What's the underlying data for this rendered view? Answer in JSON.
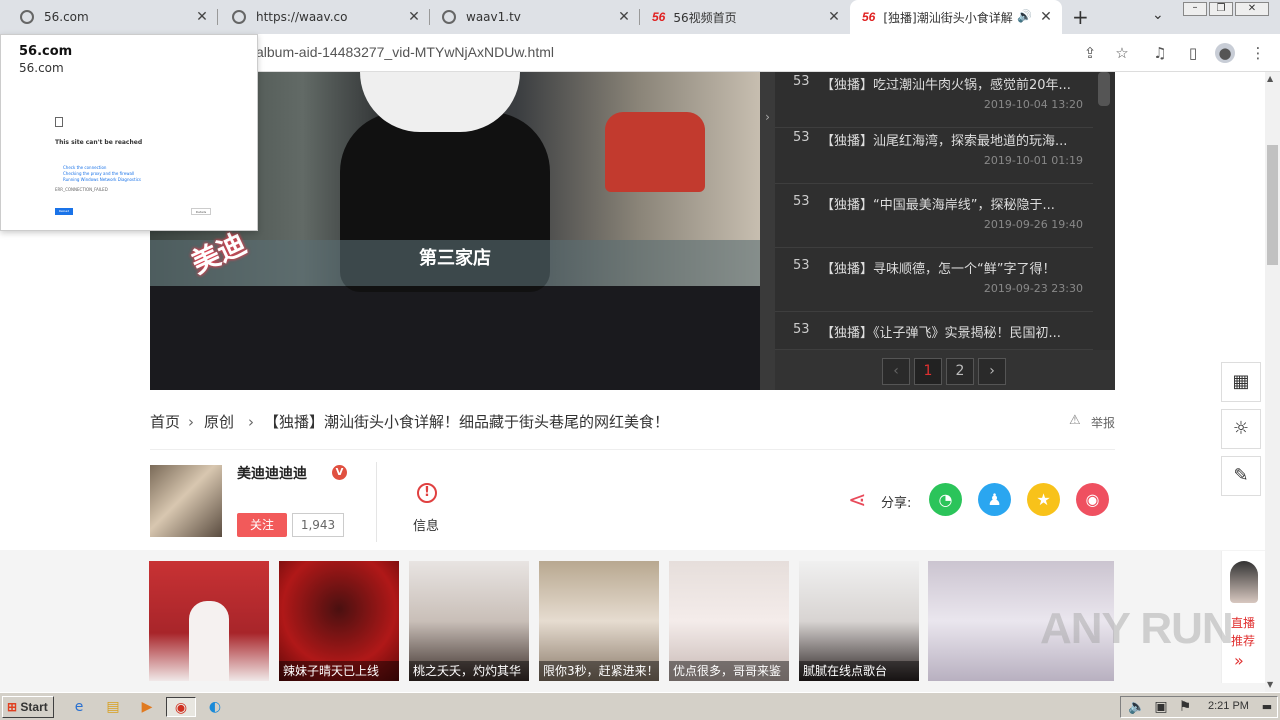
{
  "tabs": [
    {
      "title": "56.com"
    },
    {
      "title": "https://waav.co"
    },
    {
      "title": "waav1.tv"
    },
    {
      "title": "56视频首页",
      "logo": "56"
    },
    {
      "title": "[独播]潮汕街头小食详解",
      "logo": "56"
    }
  ],
  "address": {
    "url": "album-aid-14483277_vid-MTYwNjAxNDUw.html"
  },
  "popup": {
    "title": "56.com",
    "subtitle": "56.com",
    "error_title": "This site can't be reached",
    "error_lines": [
      "Check the connection",
      "Checking the proxy and the firewall",
      "Running Windows Network Diagnostics"
    ],
    "error_code": "ERR_CONNECTION_FAILED",
    "reload": "Reload",
    "details": "Details"
  },
  "video": {
    "subtitle": "第三家店",
    "stamp": "美迪"
  },
  "playlist": {
    "items": [
      {
        "num": "53",
        "title": "【独播】吃过潮汕牛肉火锅，感觉前20年...",
        "date": "2019-10-04 13:20"
      },
      {
        "num": "53",
        "title": "【独播】汕尾红海湾，探索最地道的玩海...",
        "date": "2019-10-01 01:19"
      },
      {
        "num": "53",
        "title": "【独播】“中国最美海岸线”，探秘隐于...",
        "date": "2019-09-26 19:40"
      },
      {
        "num": "53",
        "title": "【独播】寻味顺德，怎一个“鲜”字了得！",
        "date": "2019-09-23 23:30"
      },
      {
        "num": "53",
        "title": "【独播】《让子弹飞》实景揭秘！民国初...",
        "date": ""
      }
    ],
    "pages": [
      "1",
      "2"
    ],
    "current_page": "1"
  },
  "breadcrumb": {
    "home": "首页",
    "category": "原创",
    "title": "【独播】潮汕街头小食详解！细品藏于街头巷尾的网红美食！",
    "report": "举报"
  },
  "author": {
    "name": "美迪迪迪迪",
    "badge": "V",
    "follow": "关注",
    "followers": "1,943",
    "info": "信息",
    "share_label": "分享:"
  },
  "thumbs": [
    {
      "caption": ""
    },
    {
      "caption": "辣妹子晴天已上线"
    },
    {
      "caption": "桃之夭夭，灼灼其华"
    },
    {
      "caption": "限你3秒，赶紧进来！"
    },
    {
      "caption": "优点很多，哥哥来鉴"
    },
    {
      "caption": "腻腻在线点歌台"
    },
    {
      "caption": ""
    }
  ],
  "live": {
    "line1": "直播",
    "line2": "推荐"
  },
  "taskbar": {
    "start": "Start",
    "time": "2:21 PM"
  },
  "watermark": "ANY RUN"
}
